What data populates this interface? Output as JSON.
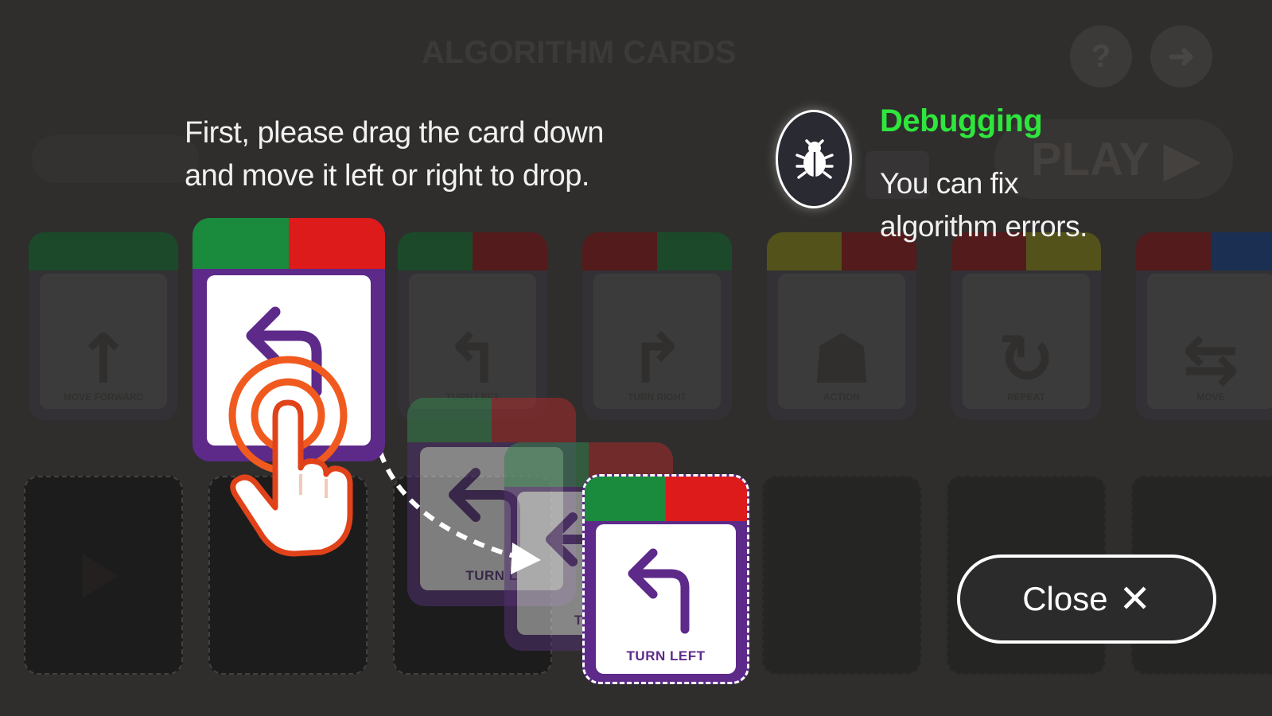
{
  "background": {
    "title": "ALGORITHM CARDS",
    "help_icon": "question-icon",
    "exit_icon": "exit-icon",
    "play_label": "PLAY",
    "play_icon": "play-triangle-icon",
    "palette_cards": [
      {
        "icon": "arrow-up-icon",
        "glyph": "↑",
        "label": "MOVE FORWARD",
        "colors": [
          "#1f5e33",
          "#1f5e33"
        ]
      },
      {
        "icon": "turn-left-icon",
        "glyph": "↰",
        "label": "TURN LEFT",
        "colors": [
          "#1f5e33",
          "#6b1e1e"
        ]
      },
      {
        "icon": "turn-right-icon",
        "glyph": "↱",
        "label": "TURN RIGHT",
        "colors": [
          "#6b1e1e",
          "#1f5e33"
        ]
      },
      {
        "icon": "robot-icon",
        "glyph": "☗",
        "label": "ACTION",
        "colors": [
          "#6b6a1e",
          "#6b1e1e"
        ]
      },
      {
        "icon": "repeat-icon",
        "glyph": "↻",
        "label": "REPEAT",
        "colors": [
          "#6b1e1e",
          "#6b6a1e"
        ]
      },
      {
        "icon": "multi-arrow-icon",
        "glyph": "⇆",
        "label": "MOVE",
        "colors": [
          "#6b1e1e",
          "#1e3a6b"
        ]
      }
    ]
  },
  "tutorial": {
    "instruction": "First, please drag the card down and move it left or right to drop.",
    "card_label": "TURN LEFT",
    "ghost_label_1": "TURN L",
    "ghost_label_2": "TUR",
    "card_header_colors": [
      "#1a8a3c",
      "#dd1b1b"
    ],
    "card_border_color": "#5d2a8a"
  },
  "debugging": {
    "icon": "bug-icon",
    "title": "Debugging",
    "description": "You can fix algorithm errors."
  },
  "close_button": {
    "label": "Close",
    "icon": "close-x-icon",
    "glyph": "✕"
  },
  "colors": {
    "title_green": "#2ee63c",
    "background": "#3a3836"
  }
}
